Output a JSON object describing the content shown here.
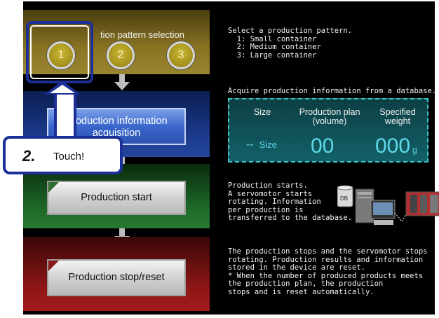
{
  "pattern": {
    "title": "tion pattern selection",
    "buttons": [
      "1",
      "2",
      "3"
    ]
  },
  "text": {
    "select": "Select a production pattern.\n  1: Small container\n  2: Medium container\n  3: Large container",
    "acquire": "Acquire production information from a database.",
    "starts": "Production starts.\nA servomotor starts\nrotating. Information\nper production is\ntransferred to the database.",
    "stops": "The production stops and the servomotor stops\nrotating. Production results and information\nstored in the device are reset.\n* When the number of produced products meets\nthe production plan, the production\nstops and is reset automatically."
  },
  "panel": {
    "size_label": "Size",
    "plan_label_1": "Production plan",
    "plan_label_2": "(volume)",
    "weight_label_1": "Specified",
    "weight_label_2": "weight",
    "size_value": "--",
    "size_unit": "Size",
    "plan_value": "00",
    "weight_value": "000",
    "weight_unit": "g"
  },
  "buttons": {
    "acquisition_1": "Production information",
    "acquisition_2": "acquisition",
    "start": "Production start",
    "stop": "Production stop/reset"
  },
  "callout": {
    "number": "2.",
    "text": "Touch!"
  },
  "device": {
    "db_label": "DB"
  },
  "colors": {
    "callout_border": "#1c2f97",
    "panel_value": "#5fd8e8",
    "panel_border": "#3fc9c9"
  }
}
